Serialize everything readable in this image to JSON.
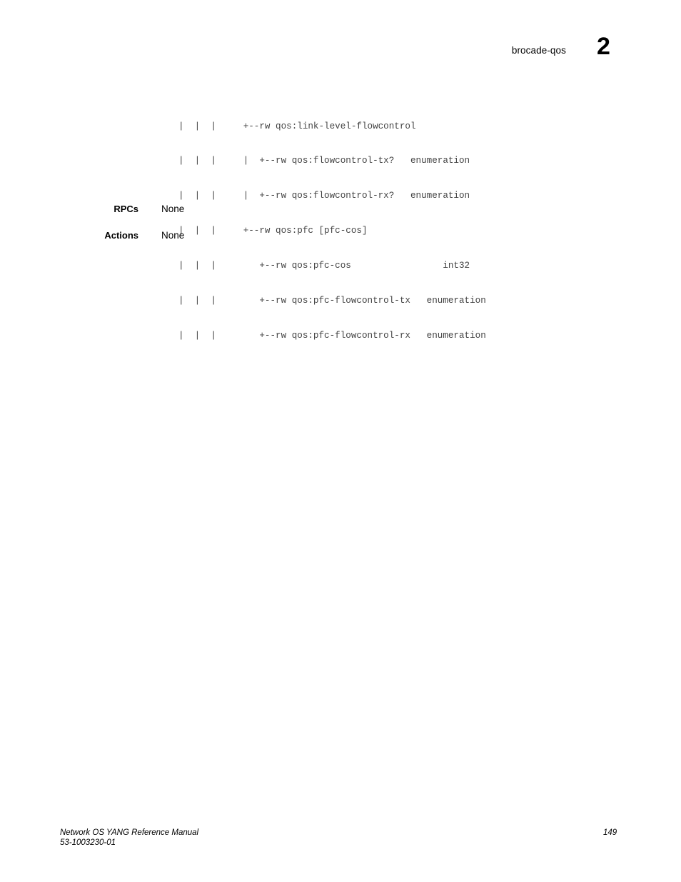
{
  "header": {
    "title": "brocade-qos",
    "chapter": "2"
  },
  "code_block": {
    "lines": [
      "|  |  |     +--rw qos:link-level-flowcontrol",
      "|  |  |     |  +--rw qos:flowcontrol-tx?   enumeration",
      "|  |  |     |  +--rw qos:flowcontrol-rx?   enumeration",
      "|  |  |     +--rw qos:pfc [pfc-cos]",
      "|  |  |        +--rw qos:pfc-cos                 int32",
      "|  |  |        +--rw qos:pfc-flowcontrol-tx   enumeration",
      "|  |  |        +--rw qos:pfc-flowcontrol-rx   enumeration"
    ]
  },
  "definitions": [
    {
      "label": "RPCs",
      "value": "None"
    },
    {
      "label": "Actions",
      "value": "None"
    }
  ],
  "footer": {
    "manual": "Network OS YANG Reference Manual",
    "doc_number": "53-1003230-01",
    "page_number": "149"
  }
}
